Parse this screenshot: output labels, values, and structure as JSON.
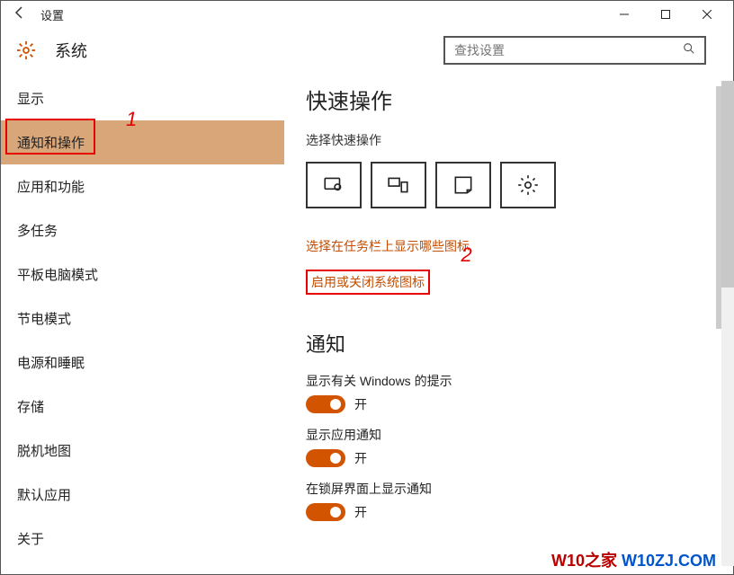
{
  "window": {
    "title": "设置"
  },
  "header": {
    "section": "系统"
  },
  "search": {
    "placeholder": "查找设置"
  },
  "sidebar": {
    "items": [
      {
        "label": "显示",
        "selected": false
      },
      {
        "label": "通知和操作",
        "selected": true
      },
      {
        "label": "应用和功能",
        "selected": false
      },
      {
        "label": "多任务",
        "selected": false
      },
      {
        "label": "平板电脑模式",
        "selected": false
      },
      {
        "label": "节电模式",
        "selected": false
      },
      {
        "label": "电源和睡眠",
        "selected": false
      },
      {
        "label": "存储",
        "selected": false
      },
      {
        "label": "脱机地图",
        "selected": false
      },
      {
        "label": "默认应用",
        "selected": false
      },
      {
        "label": "关于",
        "selected": false
      }
    ]
  },
  "content": {
    "quick_actions_heading": "快速操作",
    "choose_quick_actions": "选择快速操作",
    "link_taskbar_icons": "选择在任务栏上显示哪些图标",
    "link_system_icons": "启用或关闭系统图标",
    "notifications_heading": "通知",
    "settings": [
      {
        "label": "显示有关 Windows 的提示",
        "state": "开",
        "on": true
      },
      {
        "label": "显示应用通知",
        "state": "开",
        "on": true
      },
      {
        "label": "在锁屏界面上显示通知",
        "state": "开",
        "on": true
      }
    ]
  },
  "annotations": {
    "one": "1",
    "two": "2"
  },
  "watermark": {
    "a": "W10之家",
    "b": " W10ZJ.COM"
  }
}
